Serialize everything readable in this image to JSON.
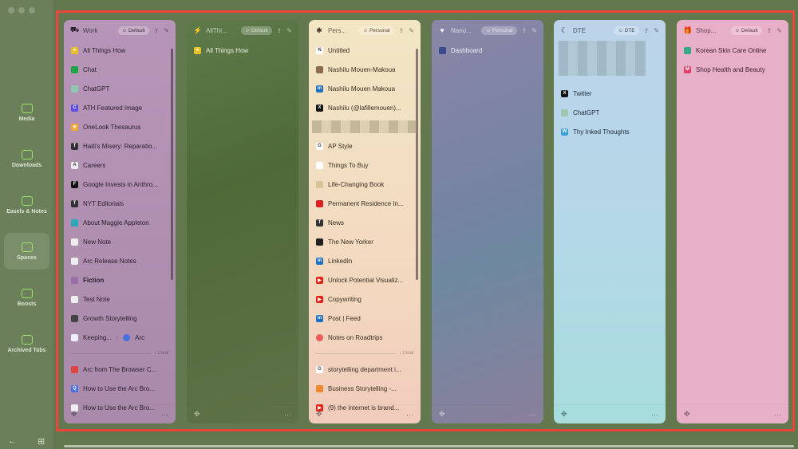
{
  "sidebar": {
    "items": [
      {
        "label": "Media",
        "icon": "media-icon",
        "active": false
      },
      {
        "label": "Downloads",
        "icon": "download-icon",
        "active": false
      },
      {
        "label": "Easels & Notes",
        "icon": "easel-icon",
        "active": false
      },
      {
        "label": "Spaces",
        "icon": "spaces-icon",
        "active": true
      },
      {
        "label": "Boosts",
        "icon": "boost-icon",
        "active": false
      },
      {
        "label": "Archived Tabs",
        "icon": "archive-icon",
        "active": false
      }
    ]
  },
  "colors": {
    "highlight_border": "#e8463a",
    "accent": "#9be36a"
  },
  "spaces": [
    {
      "name": "Work",
      "icon": "⛟",
      "profile": "Default",
      "bg": "linear-gradient(#b795b8,#a98aaa)",
      "fg": "#2b2030",
      "scroll": true,
      "pinned": [
        {
          "t": "All Things How",
          "c": "#e9c02a",
          "g": "●"
        },
        {
          "t": "Chat",
          "c": "#1ea446",
          "g": ""
        },
        {
          "t": "ChatGPT",
          "c": "#8fc7b0",
          "g": ""
        },
        {
          "t": "ATH Featured Image",
          "c": "#5c4ce0",
          "g": "C"
        },
        {
          "t": "OneLook Thesaurus",
          "c": "#f0a830",
          "g": "✳"
        },
        {
          "t": "Haiti's Misery: Reparatio...",
          "c": "#333",
          "g": "T"
        },
        {
          "t": "Careers",
          "c": "#eee",
          "g": "A"
        },
        {
          "t": "Google Invests in Anthro...",
          "c": "#111",
          "g": "F"
        },
        {
          "t": "NYT Editorials",
          "c": "#333",
          "g": "T"
        },
        {
          "t": "About Maggie Appleton",
          "c": "#2aa7b8",
          "g": ""
        },
        {
          "t": "New Note",
          "c": "#eee",
          "g": ""
        },
        {
          "t": "Arc Release Notes",
          "c": "#eee",
          "g": ""
        },
        {
          "t": "Fiction",
          "c": "#9a6fa8",
          "g": "",
          "bold": true
        },
        {
          "t": "Test Note",
          "c": "#eee",
          "g": ""
        },
        {
          "t": "Growth Storytelling",
          "c": "#444",
          "g": ""
        },
        {
          "t": "Keeping...",
          "c": "#eef",
          "g": "",
          "split": "Arc"
        }
      ],
      "clear": "Clear",
      "tabs": [
        {
          "t": "Arc from The Browser C...",
          "c": "#d44",
          "g": ""
        },
        {
          "t": "How to Use the Arc Bro...",
          "c": "#4a6de0",
          "g": "Q"
        },
        {
          "t": "How to Use the Arc Bro...",
          "c": "#eee",
          "g": ""
        }
      ]
    },
    {
      "name": "AllThi...",
      "icon": "⚡",
      "profile": "Default",
      "bg": "linear-gradient(160deg,#5e7a4a,#4f6a38 40%,#5e7147)",
      "fg": "#e8efe0",
      "scroll": false,
      "pinned": [
        {
          "t": "All Things How",
          "c": "#e9c02a",
          "g": "●"
        }
      ],
      "tabs": []
    },
    {
      "name": "Pers...",
      "icon": "✱",
      "profile": "Personal",
      "bg": "linear-gradient(#f2e6c4,#f3d7bf 70%,#f1cbbd)",
      "fg": "#3a2e22",
      "scroll": true,
      "pinned": [
        {
          "t": "Untitled",
          "c": "#fff",
          "g": "N"
        },
        {
          "t": "Nashilu Mouen-Makoua",
          "c": "#8a6a50",
          "g": ""
        },
        {
          "t": "Nashilu Mouen Makoua",
          "c": "#1f6fc0",
          "g": "in"
        },
        {
          "t": "Nashilu (@lafillemouen)...",
          "c": "#111",
          "g": "X"
        },
        {
          "blur": true
        },
        {
          "t": "AP Style",
          "c": "#fff",
          "g": "G"
        },
        {
          "t": "Things To Buy",
          "c": "#fff",
          "g": ""
        },
        {
          "t": "Life-Changing Book",
          "c": "#d9c39a",
          "g": ""
        },
        {
          "t": "Permanent Residence In...",
          "c": "#d22",
          "g": ""
        },
        {
          "t": "News",
          "c": "#333",
          "g": "T"
        },
        {
          "t": "The New Yorker",
          "c": "#222",
          "g": ""
        },
        {
          "t": "LinkedIn",
          "c": "#1f6fc0",
          "g": "in"
        },
        {
          "t": "Unlock Potential Visualiz...",
          "c": "#e62117",
          "g": "▶"
        },
        {
          "t": "Copywriting",
          "c": "#e62117",
          "g": "▶"
        },
        {
          "t": "Post | Feed",
          "c": "#1f6fc0",
          "g": "in"
        },
        {
          "t": "Notes on Roadtrips",
          "c": "#f05a5a",
          "g": "",
          "round": true
        }
      ],
      "clear": "Clear",
      "tabs": [
        {
          "t": "storytelling department i...",
          "c": "#fff",
          "g": "G"
        },
        {
          "t": "Business Storytelling -...",
          "c": "#f08a30",
          "g": ""
        },
        {
          "t": "(9) the internet is brand...",
          "c": "#e62117",
          "g": "▶"
        }
      ]
    },
    {
      "name": "Nano...",
      "icon": "♥",
      "profile": "Personal",
      "bg": "linear-gradient(160deg,#8a86a8,#7583a2 45%,#6e88a0 60%,#8a7f9c)",
      "fg": "#f0f0f6",
      "scroll": false,
      "pinned": [
        {
          "t": "Dashboard",
          "c": "#3a4a8a",
          "g": ""
        }
      ],
      "tabs": []
    },
    {
      "name": "DTE",
      "icon": "☾",
      "profile": "DTE",
      "bg": "linear-gradient(#bcd3ea,#b5d8e8 50%,#a6dcdc)",
      "fg": "#1d2a38",
      "scroll": false,
      "bigblur": true,
      "pinned": [
        {
          "t": "Twitter",
          "c": "#111",
          "g": "X"
        },
        {
          "t": "ChatGPT",
          "c": "#9cc8b0",
          "g": ""
        },
        {
          "t": "Thy Inked Thoughts",
          "c": "#3aa0d8",
          "g": "W"
        }
      ],
      "tabs": []
    },
    {
      "name": "Shop...",
      "icon": "🎁",
      "profile": "Default",
      "bg": "#e8afc8",
      "fg": "#3a1e2a",
      "scroll": false,
      "pinned": [
        {
          "t": "Korean Skin Care Online",
          "c": "#3aa882",
          "g": ""
        },
        {
          "t": "Shop Health and Beauty",
          "c": "#e0406a",
          "g": "M"
        }
      ],
      "tabs": []
    }
  ]
}
